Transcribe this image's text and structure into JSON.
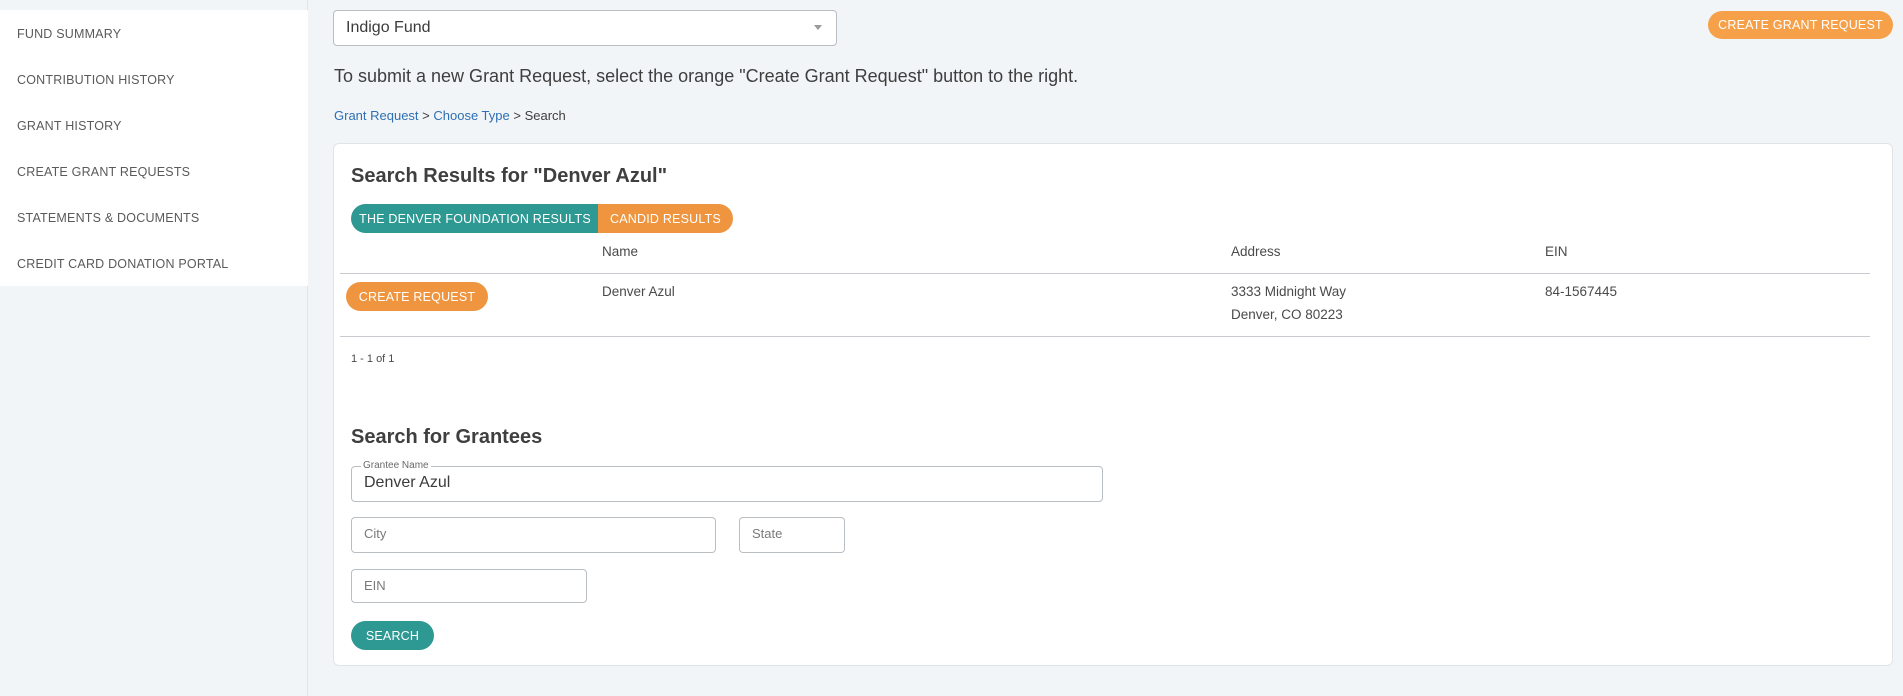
{
  "sidebar": {
    "items": [
      {
        "label": "FUND SUMMARY"
      },
      {
        "label": "CONTRIBUTION HISTORY"
      },
      {
        "label": "GRANT HISTORY"
      },
      {
        "label": "CREATE GRANT REQUESTS"
      },
      {
        "label": "STATEMENTS & DOCUMENTS"
      },
      {
        "label": "CREDIT CARD DONATION PORTAL"
      }
    ]
  },
  "header": {
    "fund_selected": "Indigo Fund",
    "create_grant_label": "CREATE GRANT REQUEST",
    "instructions": "To submit a new Grant Request, select the orange \"Create Grant Request\" button to the right."
  },
  "breadcrumb": {
    "item1": "Grant Request",
    "sep1": " > ",
    "item2": "Choose Type",
    "sep2": " > ",
    "current": "Search"
  },
  "results": {
    "title": "Search Results for \"Denver Azul\"",
    "tabs": [
      "THE DENVER FOUNDATION RESULTS",
      "CANDID RESULTS"
    ],
    "columns": [
      "Name",
      "Address",
      "EIN"
    ],
    "rows": [
      {
        "action_label": "CREATE REQUEST",
        "name": "Denver Azul",
        "address_line1": "3333 Midnight Way",
        "address_line2": "Denver, CO 80223",
        "ein": "84-1567445"
      }
    ],
    "pagination": "1 - 1 of 1"
  },
  "search": {
    "title": "Search for Grantees",
    "grantee_label": "Grantee Name",
    "grantee_value": "Denver Azul",
    "city_placeholder": "City",
    "state_placeholder": "State",
    "ein_placeholder": "EIN",
    "search_label": "SEARCH"
  },
  "colors": {
    "accent_orange": "#f0953f",
    "header_orange": "#f6a14a",
    "accent_teal": "#2e9893",
    "link_blue": "#2f6fb3"
  }
}
